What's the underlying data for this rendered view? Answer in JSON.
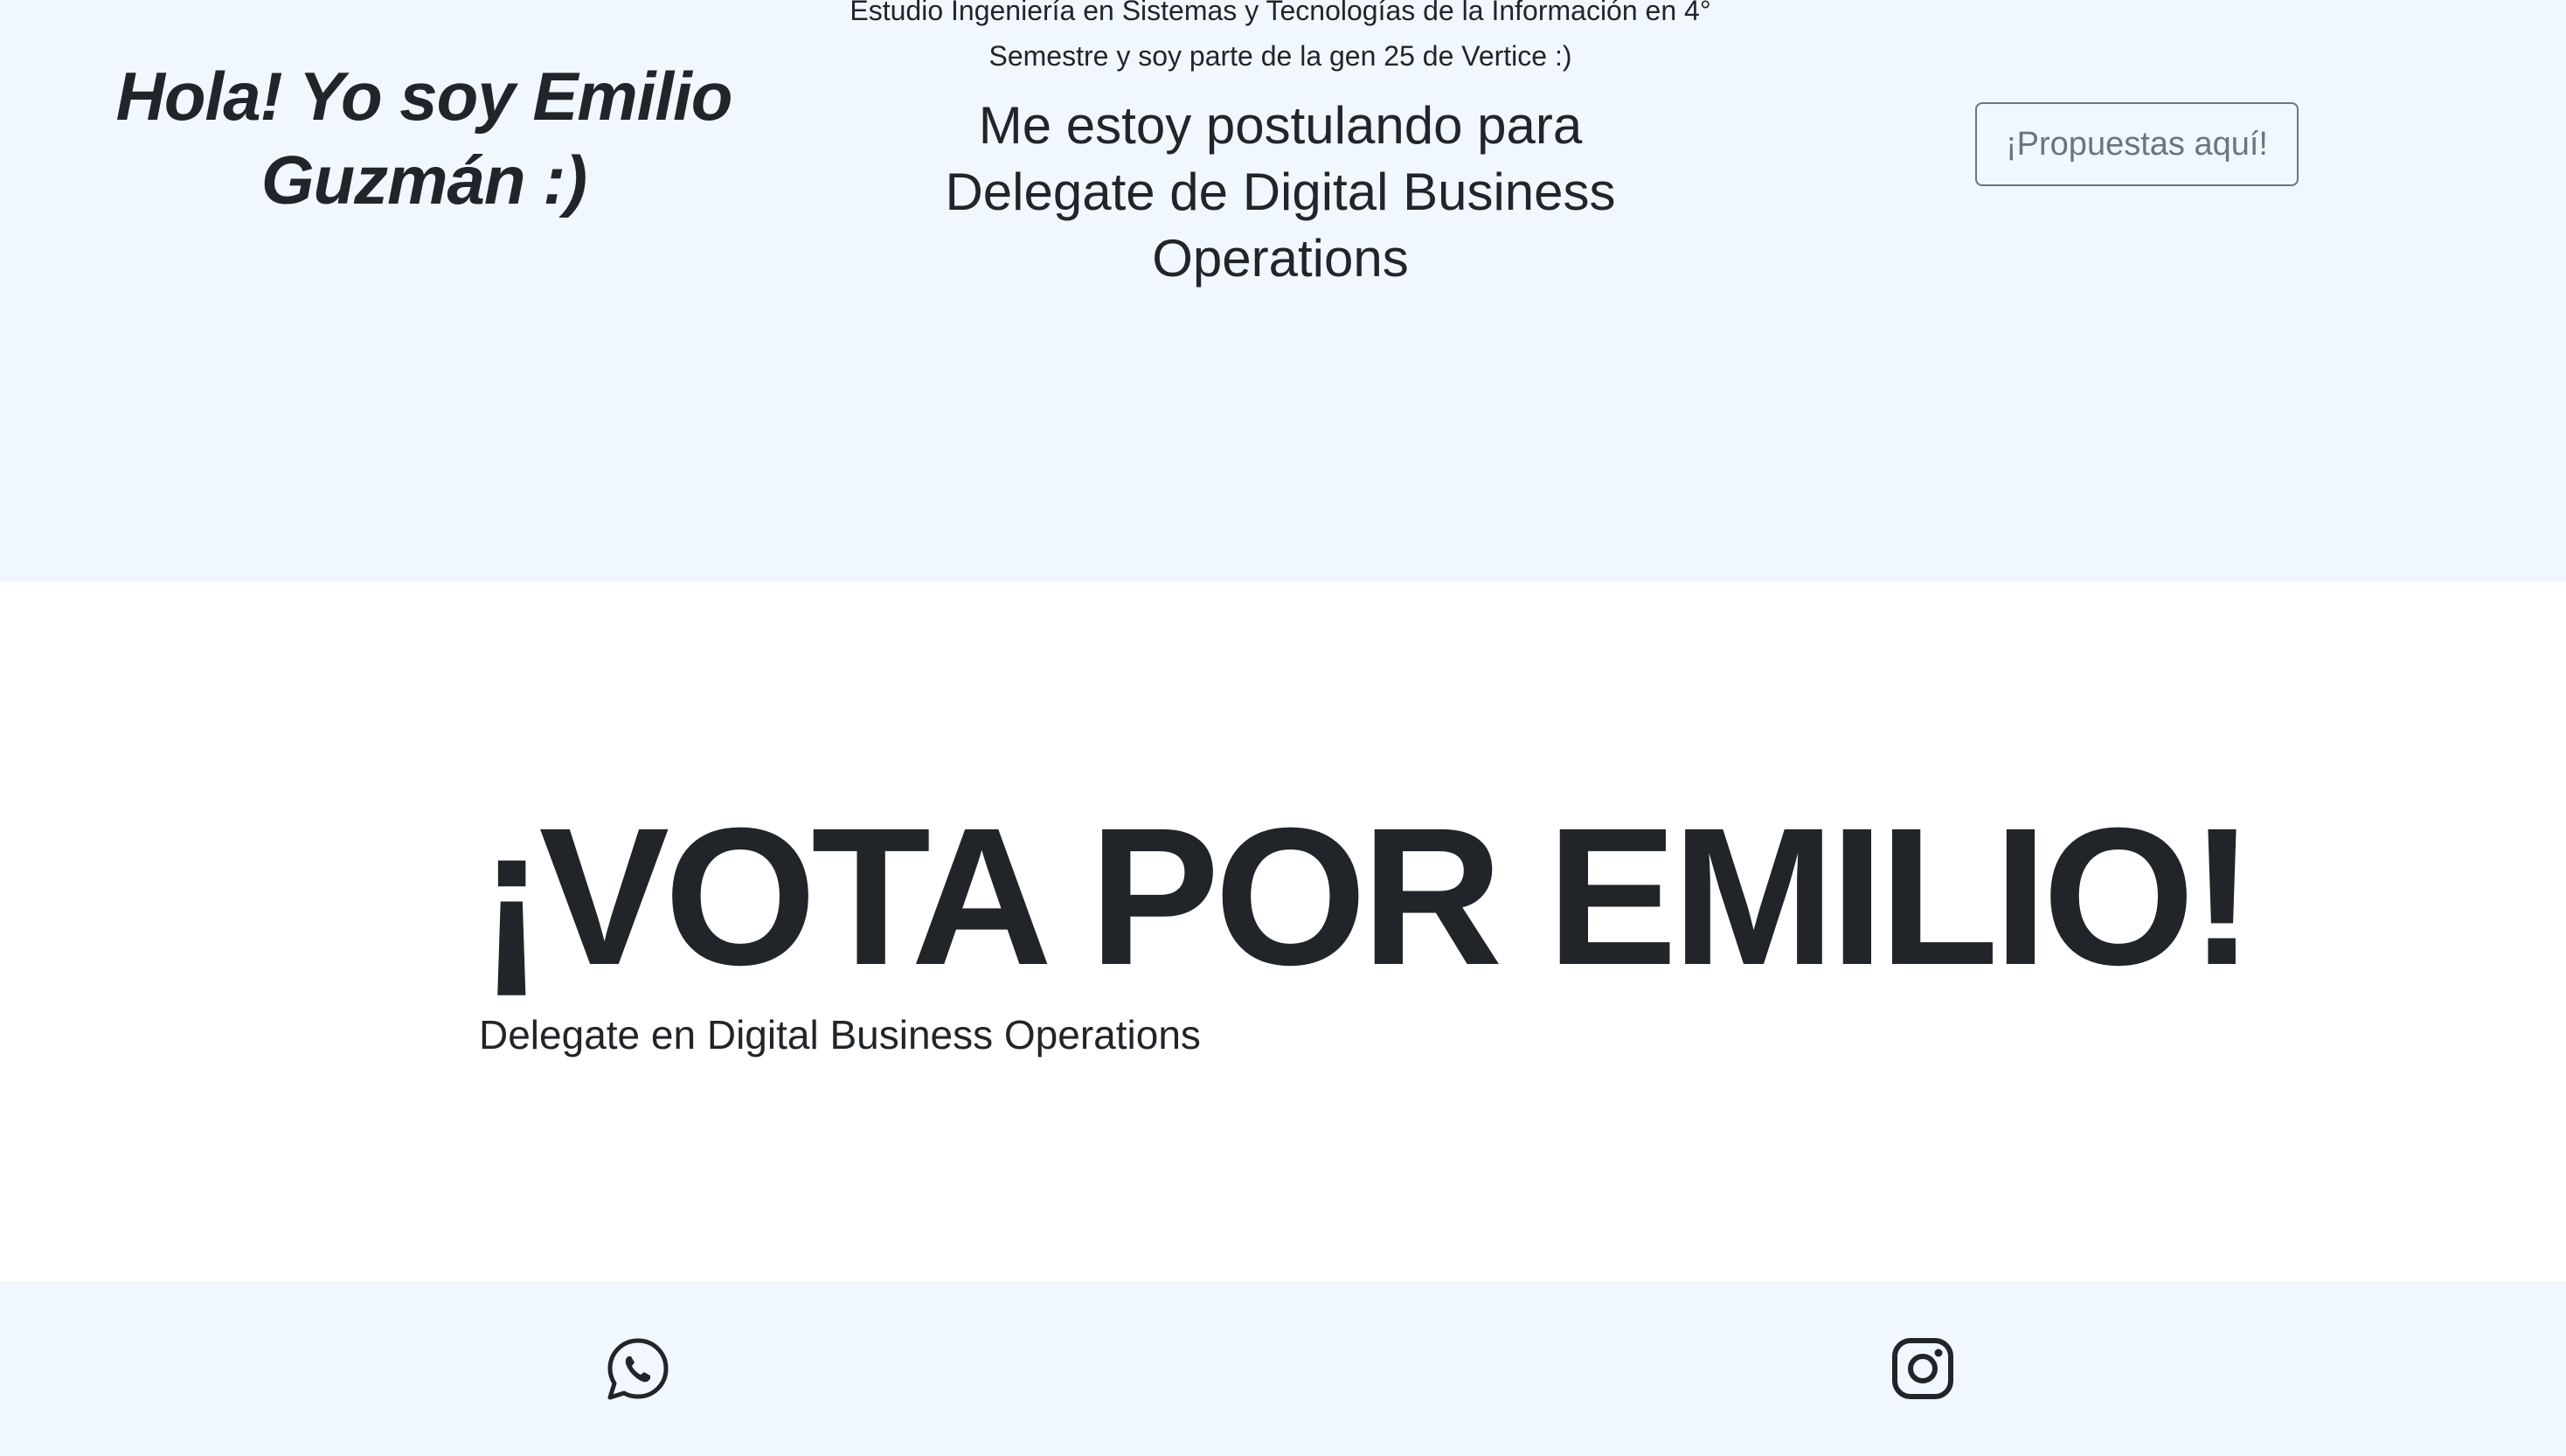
{
  "hero": {
    "greeting": "Hola! Yo soy Emilio Guzmán :)",
    "study": "Estudio Ingeniería en Sistemas y Tecnologías de la Información en 4° Semestre y soy parte de la gen 25 de Vertice :)",
    "running_for": "Me estoy postulando para Delegate de Digital Business Operations",
    "proposals_button": "¡Propuestas aquí!"
  },
  "vote": {
    "title": "¡VOTA POR EMILIO!",
    "subtitle": "Delegate en Digital Business Operations"
  },
  "footer": {
    "icons": [
      "whatsapp-icon",
      "instagram-icon"
    ]
  },
  "colors": {
    "hero_bg": "#f0f7ff",
    "text": "#212529",
    "button_outline": "#6c757d"
  }
}
